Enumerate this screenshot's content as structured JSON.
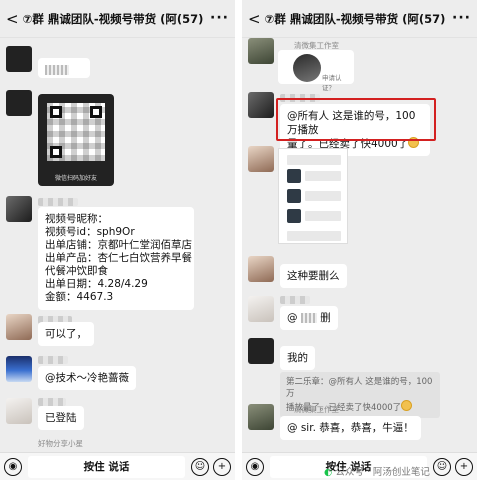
{
  "left": {
    "header": {
      "title": "⑦群 鼎诚团队-视频号带货 (阿",
      "count": "(57)"
    },
    "qr_caption": "微信扫码加好友",
    "info": {
      "l1": "视频号昵称：",
      "l2": "视频号id：sph9Or",
      "l3": "出单店铺：京都叶仁堂润佰草店",
      "l4": "出单产品：杏仁七白饮营养早餐",
      "l5": "代餐冲饮即食",
      "l6": "出单日期：4.28/4.29",
      "l7": "金额：4467.3"
    },
    "msg_ok": "可以了，",
    "msg_at": "@技术～冷艳蔷薇",
    "msg_done": "已登陆",
    "footer_name": "好物分享小星"
  },
  "right": {
    "header": {
      "title": "⑦群 鼎诚团队-视频号带货 (阿",
      "count": "(57)"
    },
    "card_label": "申请认证？",
    "card_top": "清微集工作室",
    "red_msg_1": "@所有人 这是谁的号，100万播放",
    "red_msg_2": "量了。已经卖了快4000了",
    "msg_delete": "这种要删么",
    "msg_at_delete": "@",
    "msg_at_delete_tail": "删",
    "msg_mine": "我的",
    "quote_1": "第二乐章：@所有人 这是谁的号，100万",
    "quote_2": "播放量了。已经卖了快4000了",
    "quote_name": "清微集工作室",
    "msg_congrats": "@  sir. 恭喜，恭喜，牛逼！"
  },
  "bottom": {
    "talk_label": "按住 说话",
    "voice_icon": "voice-icon",
    "emoji_icon": "emoji-icon",
    "plus_icon": "plus-icon",
    "watermark": "公众号 · 阿汤创业笔记"
  }
}
